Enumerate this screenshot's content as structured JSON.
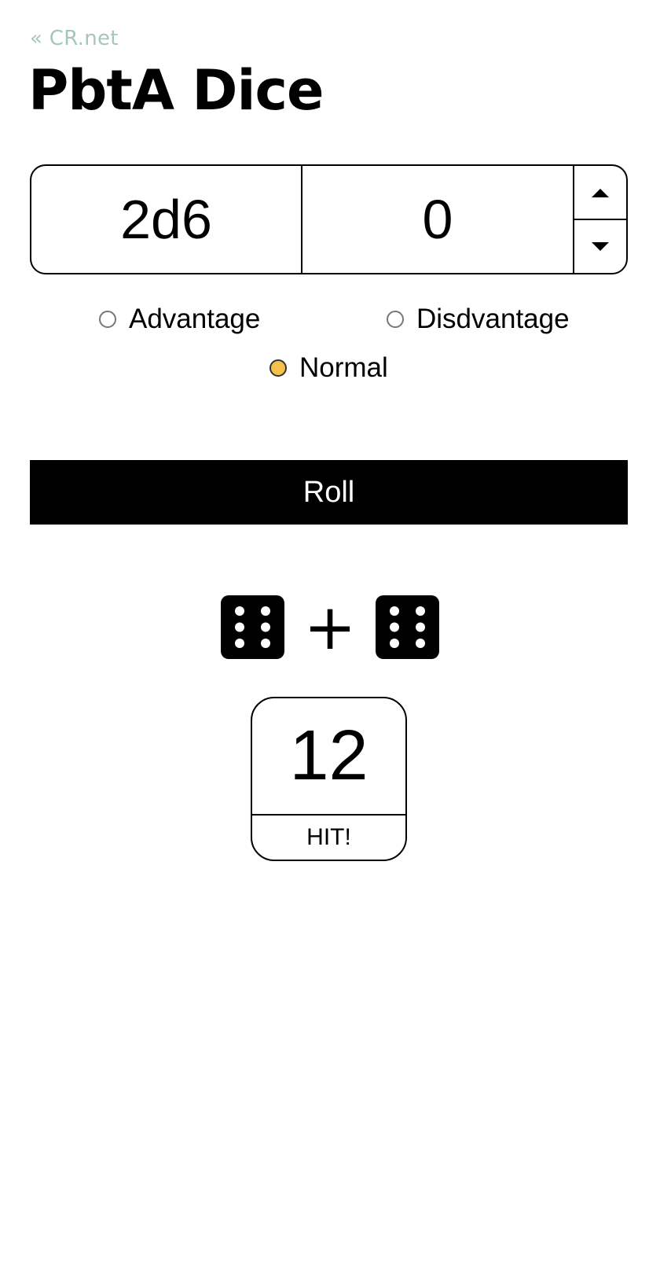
{
  "header": {
    "back_link": "« CR.net",
    "title": "PbtA Dice"
  },
  "roll_config": {
    "dice": "2d6",
    "modifier": "0",
    "stepper_up_icon": "caret-up-icon",
    "stepper_down_icon": "caret-down-icon"
  },
  "mode": {
    "options": [
      {
        "label": "Advantage",
        "checked": false
      },
      {
        "label": "Disdvantage",
        "checked": false
      },
      {
        "label": "Normal",
        "checked": true
      }
    ],
    "checked_color": "#f4c24a"
  },
  "actions": {
    "roll_label": "Roll"
  },
  "result": {
    "dice": [
      {
        "face": 6,
        "icon": "die-six-icon"
      },
      {
        "face": 6,
        "icon": "die-six-icon"
      }
    ],
    "operator": "+",
    "total": "12",
    "outcome": "HIT!"
  },
  "colors": {
    "link": "#a6c7b8",
    "button_bg": "#000000",
    "button_text": "#ffffff"
  }
}
